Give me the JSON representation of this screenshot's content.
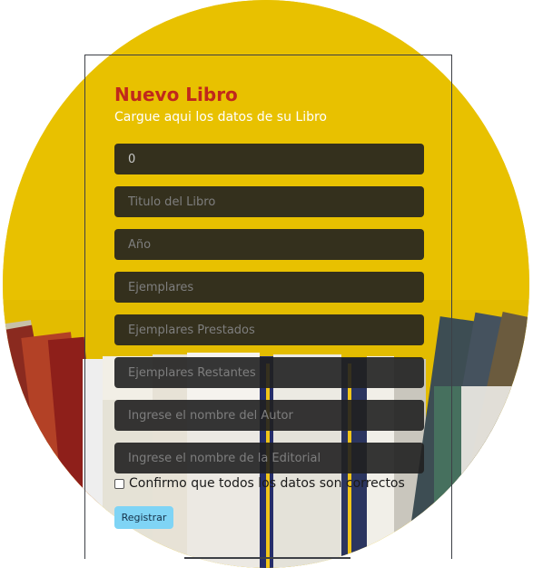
{
  "form": {
    "title": "Nuevo Libro",
    "subtitle": "Cargue aqui los datos de su Libro",
    "fields": [
      {
        "value": "0",
        "placeholder": ""
      },
      {
        "value": "",
        "placeholder": "Titulo del Libro"
      },
      {
        "value": "",
        "placeholder": "Año"
      },
      {
        "value": "",
        "placeholder": "Ejemplares"
      },
      {
        "value": "",
        "placeholder": "Ejemplares Prestados"
      },
      {
        "value": "",
        "placeholder": "Ejemplares Restantes"
      },
      {
        "value": "",
        "placeholder": "Ingrese el nombre del Autor"
      },
      {
        "value": "",
        "placeholder": "Ingrese el nombre de la Editorial"
      }
    ],
    "confirm_label": "Confirmo que todos los datos son correctos",
    "confirm_checked": false,
    "submit_label": "Registrar"
  },
  "colors": {
    "background_yellow": "#e8c100",
    "title_red": "#c0281c",
    "button_blue": "#7fd4f5",
    "field_dark": "#202020"
  }
}
